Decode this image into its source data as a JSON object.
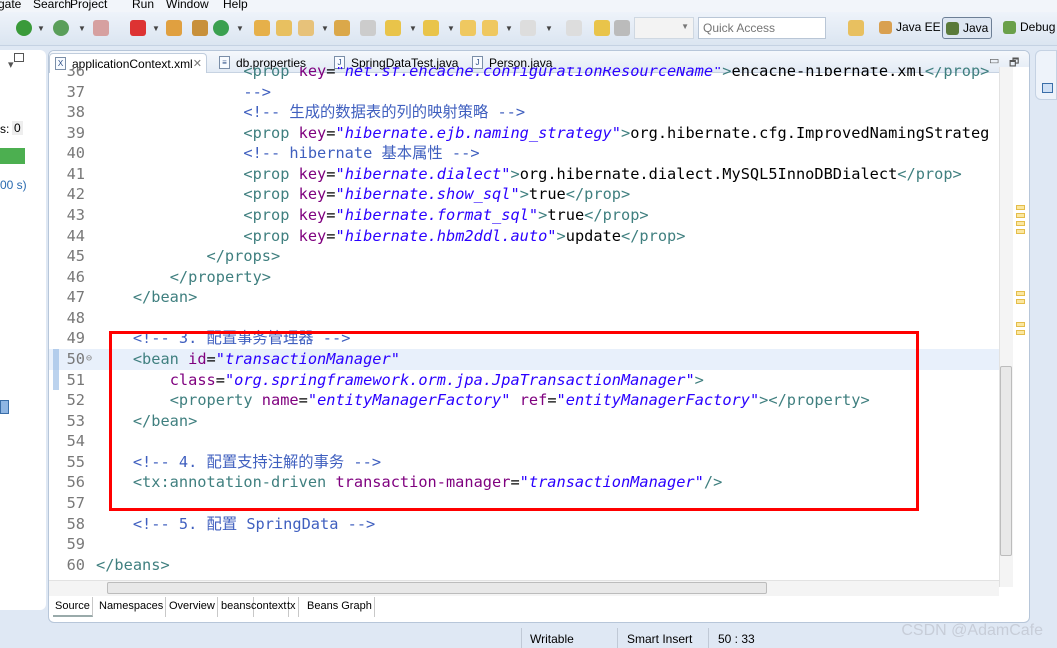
{
  "menu": [
    "gate",
    "Search",
    "Project",
    "Run",
    "Window",
    "Help"
  ],
  "toolbar": {
    "quick_access_placeholder": "Quick Access",
    "perspectives": [
      {
        "label": "Java EE",
        "icon": "java-ee-icon"
      },
      {
        "label": "Java",
        "icon": "java-icon",
        "active": true
      },
      {
        "label": "Debug",
        "icon": "debug-icon"
      }
    ]
  },
  "left_panel": {
    "count_label": "s:",
    "count_value": "0",
    "time_label": "00 s)",
    "progress_color": "#4caf50"
  },
  "editor": {
    "tabs": [
      {
        "label": "applicationContext.xml",
        "active": true,
        "icon": "xml-file-icon"
      },
      {
        "label": "db.properties",
        "icon": "properties-file-icon"
      },
      {
        "label": "SpringDataTest.java",
        "icon": "java-file-icon"
      },
      {
        "label": "Person.java",
        "icon": "java-file-icon"
      }
    ],
    "highlighted_line": 50,
    "lines": [
      {
        "n": "36",
        "t": [
          [
            "tag",
            "\t\t\t\t<prop "
          ],
          [
            "attr",
            "key"
          ],
          [
            "text",
            "="
          ],
          [
            "val",
            "\"net.sf.ehcache.configurationResourceName\""
          ],
          [
            "tag",
            ">"
          ],
          [
            "text",
            "ehcache-hibernate.xml"
          ],
          [
            "tag",
            "</prop>"
          ]
        ]
      },
      {
        "n": "37",
        "t": [
          [
            "com",
            "\t\t\t\t-->"
          ]
        ]
      },
      {
        "n": "38",
        "t": [
          [
            "com",
            "\t\t\t\t<!-- 生成的数据表的列的映射策略 -->"
          ]
        ]
      },
      {
        "n": "39",
        "t": [
          [
            "tag",
            "\t\t\t\t<prop "
          ],
          [
            "attr",
            "key"
          ],
          [
            "text",
            "="
          ],
          [
            "val",
            "\"hibernate.ejb.naming_strategy\""
          ],
          [
            "tag",
            ">"
          ],
          [
            "text",
            "org.hibernate.cfg.ImprovedNamingStrateg"
          ]
        ]
      },
      {
        "n": "40",
        "t": [
          [
            "com",
            "\t\t\t\t<!-- hibernate 基本属性 -->"
          ]
        ]
      },
      {
        "n": "41",
        "t": [
          [
            "tag",
            "\t\t\t\t<prop "
          ],
          [
            "attr",
            "key"
          ],
          [
            "text",
            "="
          ],
          [
            "val",
            "\"hibernate.dialect\""
          ],
          [
            "tag",
            ">"
          ],
          [
            "text",
            "org.hibernate.dialect.MySQL5InnoDBDialect"
          ],
          [
            "tag",
            "</prop>"
          ]
        ]
      },
      {
        "n": "42",
        "t": [
          [
            "tag",
            "\t\t\t\t<prop "
          ],
          [
            "attr",
            "key"
          ],
          [
            "text",
            "="
          ],
          [
            "val",
            "\"hibernate.show_sql\""
          ],
          [
            "tag",
            ">"
          ],
          [
            "text",
            "true"
          ],
          [
            "tag",
            "</prop>"
          ]
        ]
      },
      {
        "n": "43",
        "t": [
          [
            "tag",
            "\t\t\t\t<prop "
          ],
          [
            "attr",
            "key"
          ],
          [
            "text",
            "="
          ],
          [
            "val",
            "\"hibernate.format_sql\""
          ],
          [
            "tag",
            ">"
          ],
          [
            "text",
            "true"
          ],
          [
            "tag",
            "</prop>"
          ]
        ]
      },
      {
        "n": "44",
        "t": [
          [
            "tag",
            "\t\t\t\t<prop "
          ],
          [
            "attr",
            "key"
          ],
          [
            "text",
            "="
          ],
          [
            "val",
            "\"hibernate.hbm2ddl.auto\""
          ],
          [
            "tag",
            ">"
          ],
          [
            "text",
            "update"
          ],
          [
            "tag",
            "</prop>"
          ]
        ]
      },
      {
        "n": "45",
        "t": [
          [
            "tag",
            "\t\t\t</props>"
          ]
        ]
      },
      {
        "n": "46",
        "t": [
          [
            "tag",
            "\t\t</property>"
          ]
        ]
      },
      {
        "n": "47",
        "t": [
          [
            "tag",
            "\t</bean>"
          ]
        ]
      },
      {
        "n": "48",
        "t": []
      },
      {
        "n": "49",
        "t": [
          [
            "com",
            "\t<!-- 3. 配置事务管理器 -->"
          ]
        ]
      },
      {
        "n": "50",
        "t": [
          [
            "tag",
            "\t<bean "
          ],
          [
            "attr",
            "id"
          ],
          [
            "text",
            "="
          ],
          [
            "val",
            "\"transactionManager\""
          ]
        ]
      },
      {
        "n": "51",
        "t": [
          [
            "attr",
            "\t\tclass"
          ],
          [
            "text",
            "="
          ],
          [
            "val",
            "\"org.springframework.orm.jpa.JpaTransactionManager\""
          ],
          [
            "tag",
            ">"
          ]
        ]
      },
      {
        "n": "52",
        "t": [
          [
            "tag",
            "\t\t<property "
          ],
          [
            "attr",
            "name"
          ],
          [
            "text",
            "="
          ],
          [
            "val",
            "\"entityManagerFactory\" "
          ],
          [
            "attr",
            "ref"
          ],
          [
            "text",
            "="
          ],
          [
            "val",
            "\"entityManagerFactory\""
          ],
          [
            "tag",
            "></property>"
          ]
        ]
      },
      {
        "n": "53",
        "t": [
          [
            "tag",
            "\t</bean>"
          ]
        ]
      },
      {
        "n": "54",
        "t": []
      },
      {
        "n": "55",
        "t": [
          [
            "com",
            "\t<!-- 4. 配置支持注解的事务 -->"
          ]
        ]
      },
      {
        "n": "56",
        "t": [
          [
            "tag",
            "\t<tx:annotation-driven "
          ],
          [
            "attr",
            "transaction-manager"
          ],
          [
            "text",
            "="
          ],
          [
            "val",
            "\"transactionManager\""
          ],
          [
            "tag",
            "/>"
          ]
        ]
      },
      {
        "n": "57",
        "t": []
      },
      {
        "n": "58",
        "t": [
          [
            "com",
            "\t<!-- 5. 配置 SpringData -->"
          ]
        ]
      },
      {
        "n": "59",
        "t": []
      },
      {
        "n": "60",
        "t": [
          [
            "tag",
            "</beans>"
          ]
        ]
      }
    ],
    "bottom_tabs": [
      {
        "label": "Source",
        "active": true
      },
      {
        "label": "Namespaces"
      },
      {
        "label": "Overview"
      },
      {
        "label": "beans"
      },
      {
        "label": "context"
      },
      {
        "label": "tx"
      },
      {
        "label": "Beans Graph"
      }
    ]
  },
  "status": {
    "writable": "Writable",
    "insert_mode": "Smart Insert",
    "cursor_position": "50 : 33"
  },
  "watermark": "CSDN @AdamCafe",
  "colors": {
    "annotation_box": "#ff0000",
    "tag": "#3f7f7f",
    "attribute": "#7f007f",
    "value": "#2a00ff",
    "comment": "#3f5fbf"
  }
}
